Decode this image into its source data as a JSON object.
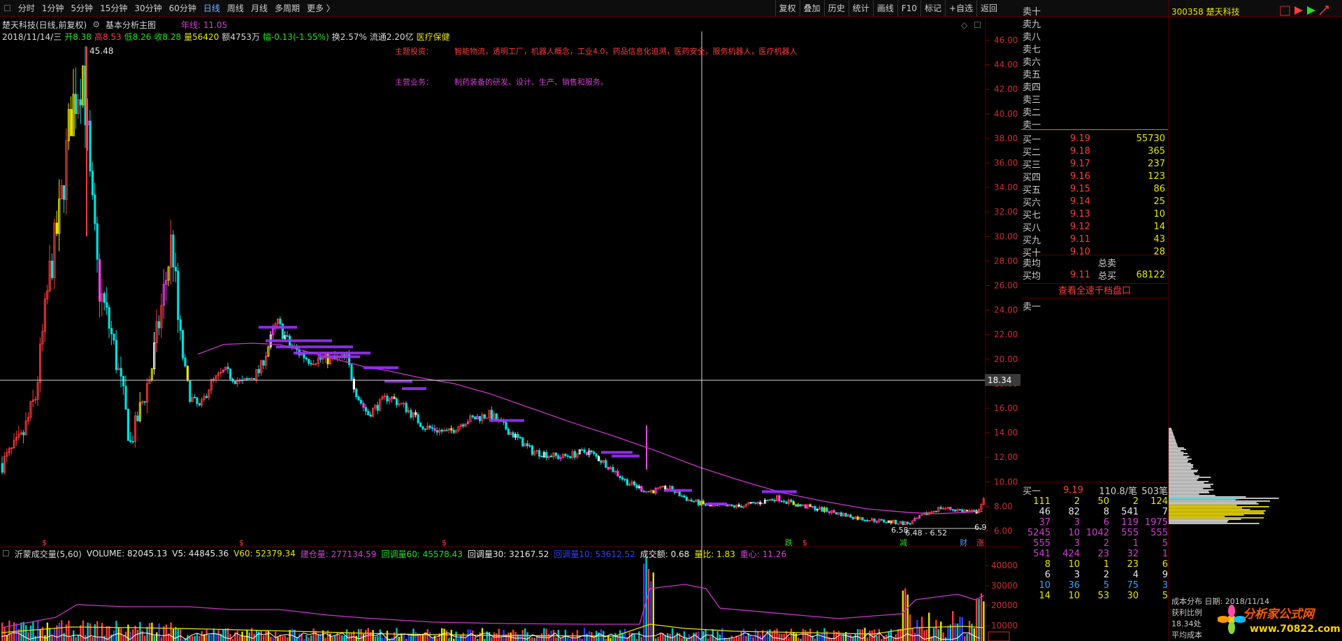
{
  "toolbar": {
    "items": [
      "分时",
      "1分钟",
      "5分钟",
      "15分钟",
      "30分钟",
      "60分钟",
      "日线",
      "周线",
      "月线",
      "多周期",
      "更多 〉"
    ],
    "active": "日线",
    "right_items": [
      "复权",
      "叠加",
      "历史",
      "统计",
      "画线",
      "F10",
      "标记",
      "+自选",
      "返回"
    ]
  },
  "header": {
    "stock_title": "楚天科技(日线,前复权)",
    "chart_label": "基本分析主图",
    "ma_label": "年线: 11.05",
    "date": "2018/11/14/三",
    "open": "开8.38",
    "high": "高8.53",
    "low": "低8.26",
    "close": "收8.28",
    "volume": "量56420",
    "amount": "额4753万",
    "change": "幅-0.13(-1.55%)",
    "turnover": "换2.57%",
    "float": "流通2.20亿",
    "sector": "医疗保健"
  },
  "annotations": {
    "theme_label": "主题投资：",
    "theme_text": "智能物流，透明工厂，机器人概念，工业4.0，药品信息化追溯，医药安全，服务机器人，医疗机器人",
    "business_label": "主营业务：",
    "business_text": "制药装备的研发、设计、生产、销售和服务。",
    "peak_label": "45.48",
    "crosshair_price": "18.34",
    "low_label1": "6.58",
    "low_label2": "6.48 - 6.52",
    "edge_label": "6.9",
    "markers": [
      "$",
      "$",
      "$",
      "跌",
      "$",
      "减",
      "财",
      "涨"
    ]
  },
  "price_axis": [
    "46.00",
    "44.00",
    "42.00",
    "40.00",
    "38.00",
    "36.00",
    "34.00",
    "32.00",
    "30.00",
    "28.00",
    "26.00",
    "24.00",
    "22.00",
    "20.00",
    "18.00",
    "16.00",
    "14.00",
    "12.00",
    "10.00",
    "8.00",
    "6.00"
  ],
  "volume_axis": [
    "40000",
    "30000",
    "20000",
    "10000"
  ],
  "volume_header": {
    "name": "沂蒙成交量(5,60)",
    "volume": "VOLUME: 82045.13",
    "v5": "V5: 44845.36",
    "v60": "V60: 52379.34",
    "jiancang": "建仓量: 277134.59",
    "h60": "回调量60: 45578.43",
    "h30": "回调量30: 32167.52",
    "h10": "回调量10: 53612.52",
    "amount": "成交额: 0.68",
    "ratio": "量比: 1.83",
    "center": "重心: 11.26"
  },
  "orderbook": {
    "asks": [
      "卖十",
      "卖九",
      "卖八",
      "卖七",
      "卖六",
      "卖五",
      "卖四",
      "卖三",
      "卖二",
      "卖一"
    ],
    "bids": [
      {
        "label": "买一",
        "price": "9.19",
        "qty": "55730"
      },
      {
        "label": "买二",
        "price": "9.18",
        "qty": "365"
      },
      {
        "label": "买三",
        "price": "9.17",
        "qty": "237"
      },
      {
        "label": "买四",
        "price": "9.16",
        "qty": "123"
      },
      {
        "label": "买五",
        "price": "9.15",
        "qty": "86"
      },
      {
        "label": "买六",
        "price": "9.14",
        "qty": "25"
      },
      {
        "label": "买七",
        "price": "9.13",
        "qty": "10"
      },
      {
        "label": "买八",
        "price": "9.12",
        "qty": "14"
      },
      {
        "label": "买九",
        "price": "9.11",
        "qty": "43"
      },
      {
        "label": "买十",
        "price": "9.10",
        "qty": "28"
      }
    ],
    "ask_avg_label": "卖均",
    "total_sell_label": "总卖",
    "bid_avg_label": "买均",
    "bid_avg": "9.11",
    "total_buy_label": "总买",
    "total_buy": "68122",
    "qiandang": "查看全速千档盘口",
    "sell1": "卖一"
  },
  "ticks": {
    "label": "买一",
    "price": "9.19",
    "per_trade": "110.8/笔",
    "count": "503笔",
    "rows": [
      [
        "111",
        "2",
        "50",
        "2",
        "124"
      ],
      [
        "46",
        "82",
        "8",
        "541",
        "7"
      ],
      [
        "37",
        "3",
        "6",
        "119",
        "1975"
      ],
      [
        "5245",
        "10",
        "1042",
        "555",
        "555"
      ],
      [
        "555",
        "3",
        "2",
        "1",
        "5"
      ],
      [
        "541",
        "424",
        "23",
        "32",
        "1"
      ],
      [
        "8",
        "10",
        "1",
        "23",
        "6"
      ],
      [
        "6",
        "3",
        "2",
        "4",
        "9"
      ],
      [
        "10",
        "36",
        "5",
        "75",
        "3"
      ],
      [
        "14",
        "10",
        "53",
        "30",
        "5"
      ]
    ]
  },
  "chip": {
    "stock": "300358 楚天科技",
    "footer1": "成本分布 日期: 2018/11/14",
    "footer2": "获利比例",
    "footer3": "18.34处",
    "footer4": "平均成本"
  },
  "logo": {
    "text1": "分析家公式网",
    "text2": "www.70822.com"
  }
}
